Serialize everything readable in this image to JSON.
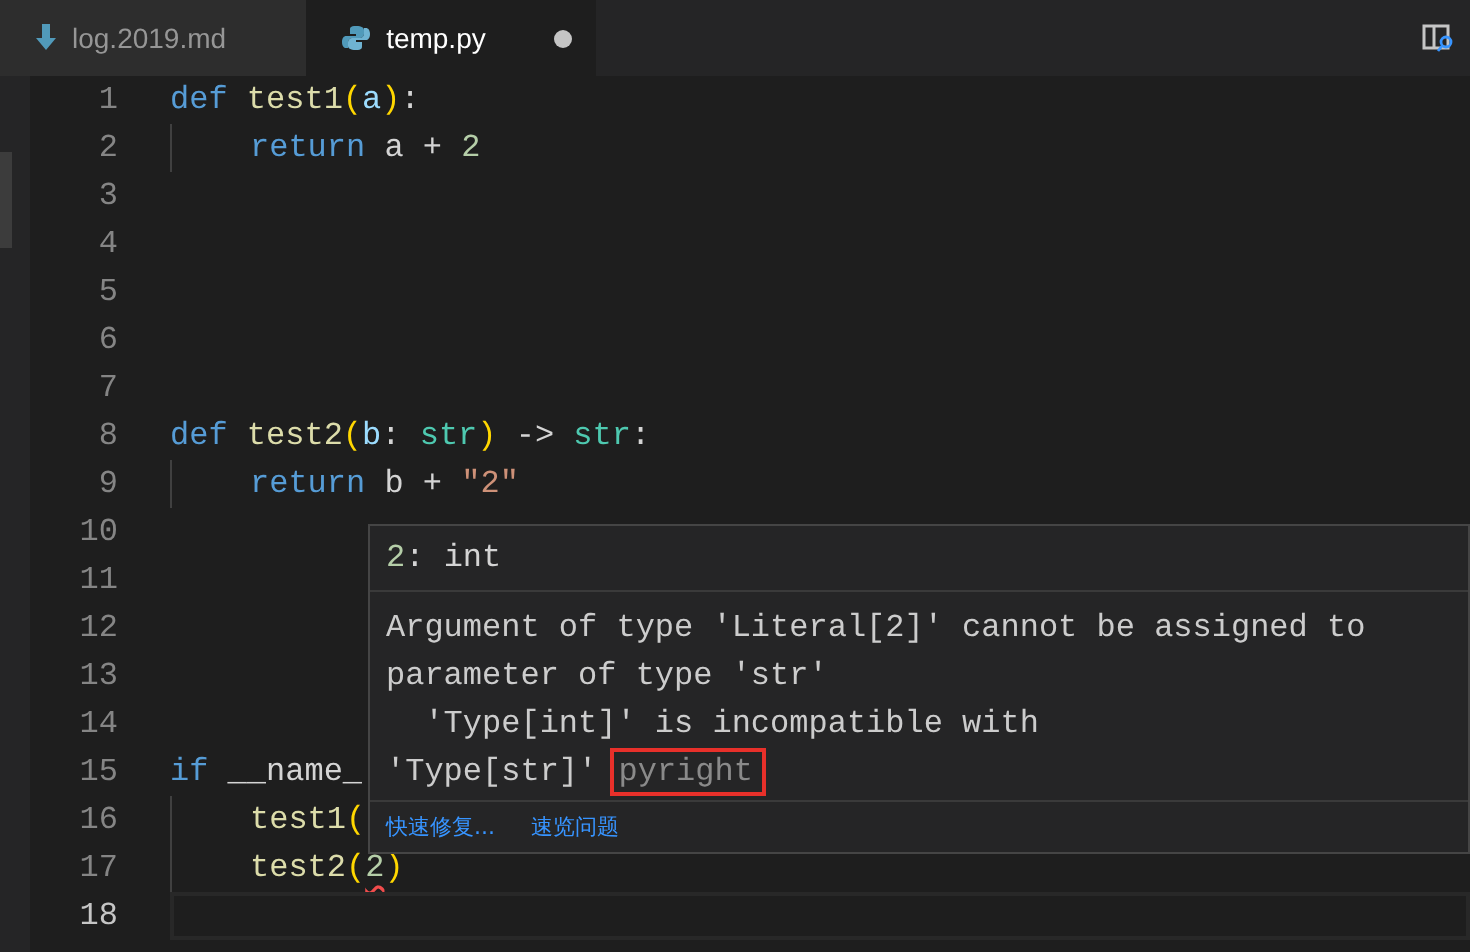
{
  "tabs": [
    {
      "label": "log.2019.md",
      "kind": "markdown",
      "selected": false,
      "modified": false
    },
    {
      "label": "temp.py",
      "kind": "python",
      "selected": true,
      "modified": true
    }
  ],
  "editor": {
    "lines": [
      {
        "number": "1",
        "indented": false,
        "current": false,
        "tokens": [
          {
            "t": "def ",
            "kind": "keyword"
          },
          {
            "t": "test1",
            "kind": "function"
          },
          {
            "t": "(",
            "kind": "bracket"
          },
          {
            "t": "a",
            "kind": "param"
          },
          {
            "t": ")",
            "kind": "bracket"
          },
          {
            "t": ":",
            "kind": "plain"
          }
        ]
      },
      {
        "number": "2",
        "indented": true,
        "current": false,
        "tokens": [
          {
            "t": "return",
            "kind": "keyword"
          },
          {
            "t": " a + ",
            "kind": "plain"
          },
          {
            "t": "2",
            "kind": "number"
          }
        ]
      },
      {
        "number": "3",
        "indented": false,
        "current": false
      },
      {
        "number": "4",
        "indented": false,
        "current": false
      },
      {
        "number": "5",
        "indented": false,
        "current": false
      },
      {
        "number": "6",
        "indented": false,
        "current": false
      },
      {
        "number": "7",
        "indented": false,
        "current": false
      },
      {
        "number": "8",
        "indented": false,
        "current": false,
        "tokens": [
          {
            "t": "def ",
            "kind": "keyword"
          },
          {
            "t": "test2",
            "kind": "function"
          },
          {
            "t": "(",
            "kind": "bracket"
          },
          {
            "t": "b",
            "kind": "param"
          },
          {
            "t": ": ",
            "kind": "plain"
          },
          {
            "t": "str",
            "kind": "type"
          },
          {
            "t": ")",
            "kind": "bracket"
          },
          {
            "t": " -> ",
            "kind": "plain"
          },
          {
            "t": "str",
            "kind": "type"
          },
          {
            "t": ":",
            "kind": "plain"
          }
        ]
      },
      {
        "number": "9",
        "indented": true,
        "current": false,
        "tokens": [
          {
            "t": "return",
            "kind": "keyword"
          },
          {
            "t": " b + ",
            "kind": "plain"
          },
          {
            "t": "\"2\"",
            "kind": "string"
          }
        ]
      },
      {
        "number": "10",
        "indented": false,
        "current": false
      },
      {
        "number": "11",
        "indented": false,
        "current": false
      },
      {
        "number": "12",
        "indented": false,
        "current": false
      },
      {
        "number": "13",
        "indented": false,
        "current": false
      },
      {
        "number": "14",
        "indented": false,
        "current": false
      },
      {
        "number": "15",
        "indented": false,
        "current": false,
        "tokens": [
          {
            "t": "if",
            "kind": "keyword"
          },
          {
            "t": " __name_",
            "kind": "plain"
          }
        ]
      },
      {
        "number": "16",
        "indented": true,
        "current": false,
        "tokens": [
          {
            "t": "test1",
            "kind": "function"
          },
          {
            "t": "(",
            "kind": "bracket"
          }
        ]
      },
      {
        "number": "17",
        "indented": true,
        "current": false,
        "tokens": [
          {
            "t": "test2",
            "kind": "function"
          },
          {
            "t": "(",
            "kind": "bracket"
          },
          {
            "t": "2",
            "kind": "number",
            "error": true
          },
          {
            "t": ")",
            "kind": "bracket"
          }
        ]
      },
      {
        "number": "18",
        "indented": false,
        "current": true
      }
    ]
  },
  "hover": {
    "header": [
      {
        "t": "2",
        "kind": "number"
      },
      {
        "t": ": int",
        "kind": "plain"
      }
    ],
    "message_lines": [
      "Argument of type 'Literal[2]' cannot be assigned to",
      "parameter of type 'str'",
      "  'Type[int]' is incompatible with",
      "'Type[str]'"
    ],
    "source": {
      "text": "pyright",
      "highlighted": true
    },
    "actions": [
      "快速修复...",
      "速览问题"
    ]
  }
}
